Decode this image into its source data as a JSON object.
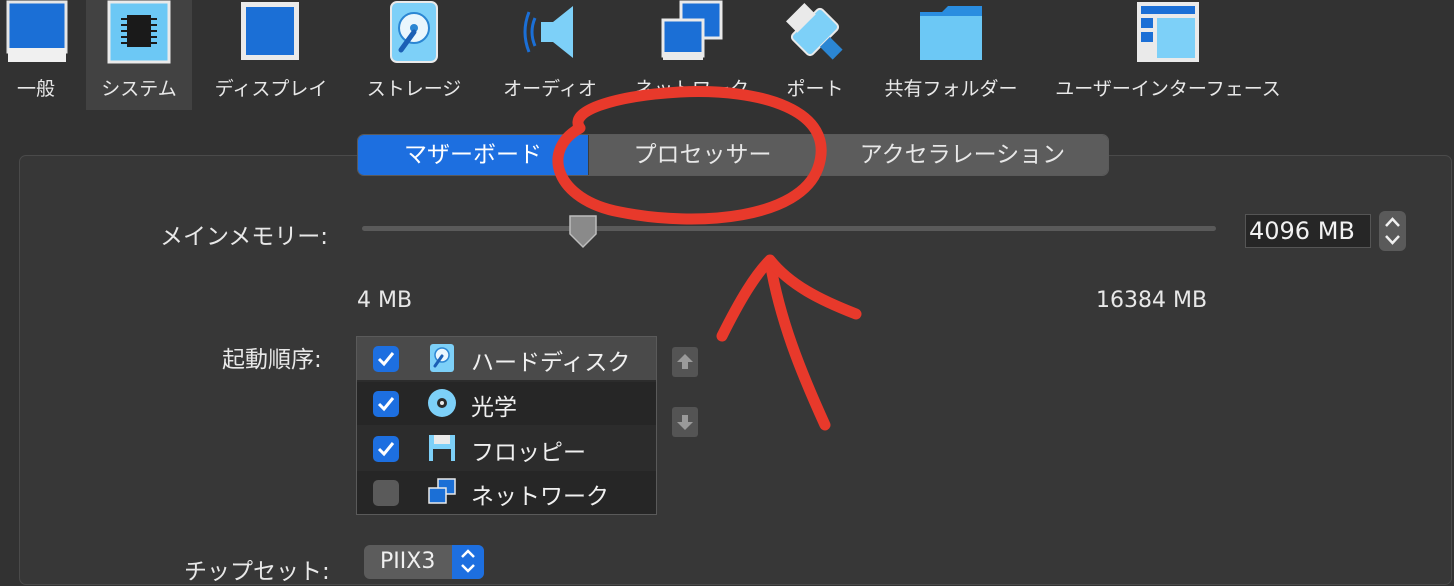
{
  "toolbar": {
    "items": [
      {
        "label": "一般",
        "icon": "monitor-general-icon"
      },
      {
        "label": "システム",
        "icon": "chip-icon",
        "selected": true
      },
      {
        "label": "ディスプレイ",
        "icon": "display-icon"
      },
      {
        "label": "ストレージ",
        "icon": "hard-disk-icon"
      },
      {
        "label": "オーディオ",
        "icon": "speaker-icon"
      },
      {
        "label": "ネットワーク",
        "icon": "network-icon"
      },
      {
        "label": "ポート",
        "icon": "port-icon"
      },
      {
        "label": "共有フォルダー",
        "icon": "folder-icon"
      },
      {
        "label": "ユーザーインターフェース",
        "icon": "window-layout-icon"
      }
    ]
  },
  "tabs": [
    {
      "label": "マザーボード",
      "active": true
    },
    {
      "label": "プロセッサー",
      "active": false
    },
    {
      "label": "アクセラレーション",
      "active": false
    }
  ],
  "memory": {
    "label": "メインメモリー:",
    "value": "4096 MB",
    "min_label": "4 MB",
    "max_label": "16384 MB"
  },
  "boot_order": {
    "label": "起動順序:",
    "items": [
      {
        "label": "ハードディスク",
        "checked": true,
        "icon": "hard-disk-icon"
      },
      {
        "label": "光学",
        "checked": true,
        "icon": "optical-disc-icon"
      },
      {
        "label": "フロッピー",
        "checked": true,
        "icon": "floppy-icon"
      },
      {
        "label": "ネットワーク",
        "checked": false,
        "icon": "network-icon"
      }
    ]
  },
  "chipset": {
    "label": "チップセット:",
    "value": "PIIX3"
  },
  "colors": {
    "accent": "#1d6fe0",
    "annotation": "#e8392b",
    "background": "#323232"
  }
}
